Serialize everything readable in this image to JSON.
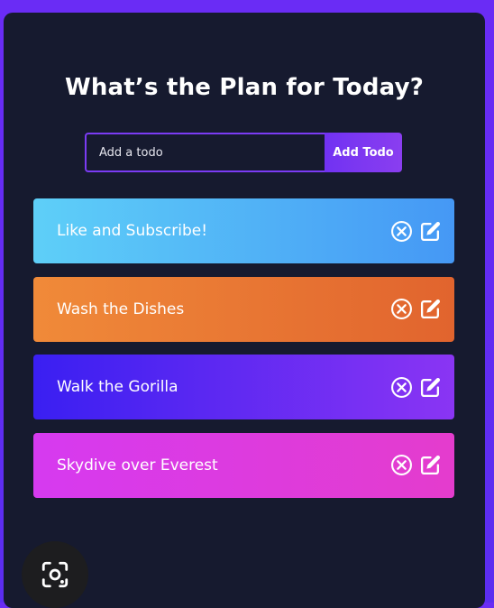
{
  "app": {
    "title": "What’s the Plan for Today?"
  },
  "form": {
    "placeholder": "Add a todo",
    "value": "",
    "button_label": "Add Todo"
  },
  "todos": [
    {
      "text": "Like and Subscribe!",
      "gradient": [
        "#5ecff8",
        "#4598f5"
      ]
    },
    {
      "text": "Wash the Dishes",
      "gradient": [
        "#f08a39",
        "#e1642e"
      ]
    },
    {
      "text": "Walk the Gorilla",
      "gradient": [
        "#3a1ff2",
        "#8a35f3"
      ]
    },
    {
      "text": "Skydive over Everest",
      "gradient": [
        "#d63af0",
        "#e43ccd"
      ]
    }
  ],
  "icons": {
    "delete": "close-circle-icon",
    "edit": "edit-icon",
    "lens": "google-lens-icon"
  },
  "colors": {
    "background": "#161a2f",
    "accent": "#7b3bf4"
  }
}
